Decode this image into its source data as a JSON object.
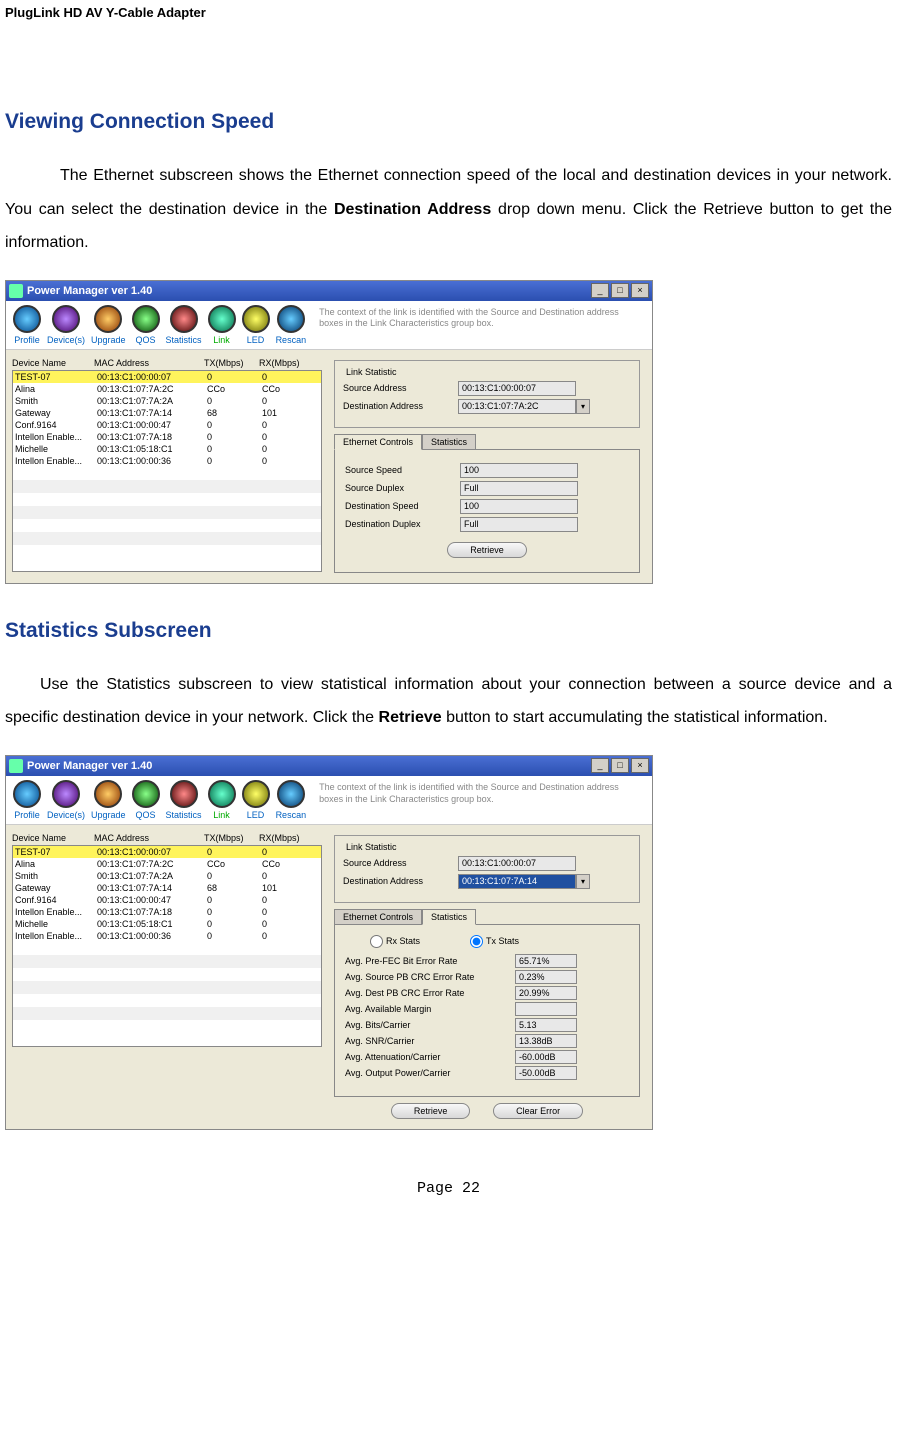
{
  "page_header": "PlugLink HD AV Y-Cable Adapter",
  "section1": {
    "title": "Viewing Connection Speed",
    "para": "The Ethernet subscreen shows the Ethernet connection speed of the local and destination devices in your network. You can select the destination device in the ",
    "bold": "Destination Address",
    "para2": " drop down menu. Click the Retrieve button to get the information."
  },
  "section2": {
    "title": "Statistics Subscreen",
    "para1": "Use the Statistics subscreen to view statistical information about your connection between a source device and a specific destination device in your network. Click the ",
    "bold": "Retrieve",
    "para2": " button to start accumulating the statistical information."
  },
  "app": {
    "title": "Power Manager ver 1.40",
    "context": "The context of the link is identified with the Source and Destination address boxes in the Link Characteristics group box.",
    "toolbar": {
      "profile": "Profile",
      "devices": "Device(s)",
      "upgrade": "Upgrade",
      "qos": "QOS",
      "stats": "Statistics",
      "link": "Link",
      "led": "LED",
      "rescan": "Rescan"
    },
    "headers": {
      "name": "Device Name",
      "mac": "MAC Address",
      "tx": "TX(Mbps)",
      "rx": "RX(Mbps)"
    },
    "rows": [
      {
        "name": "TEST-07",
        "mac": "00:13:C1:00:00:07",
        "tx": "0",
        "rx": "0"
      },
      {
        "name": "Alina",
        "mac": "00:13:C1:07:7A:2C",
        "tx": "CCo",
        "rx": "CCo"
      },
      {
        "name": "Smith",
        "mac": "00:13:C1:07:7A:2A",
        "tx": "0",
        "rx": "0"
      },
      {
        "name": "Gateway",
        "mac": "00:13:C1:07:7A:14",
        "tx": "68",
        "rx": "101"
      },
      {
        "name": "Conf.9164",
        "mac": "00:13:C1:00:00:47",
        "tx": "0",
        "rx": "0"
      },
      {
        "name": "Intellon Enable...",
        "mac": "00:13:C1:07:7A:18",
        "tx": "0",
        "rx": "0"
      },
      {
        "name": "Michelle",
        "mac": "00:13:C1:05:18:C1",
        "tx": "0",
        "rx": "0"
      },
      {
        "name": "Intellon Enable...",
        "mac": "00:13:C1:00:00:36",
        "tx": "0",
        "rx": "0"
      }
    ],
    "link_group": "Link Statistic",
    "src_addr_label": "Source Address",
    "dst_addr_label": "Destination Address",
    "src_addr": "00:13:C1:00:00:07",
    "dst_addr1": "00:13:C1:07:7A:2C",
    "dst_addr2": "00:13:C1:07:7A:14",
    "tab_eth": "Ethernet Controls",
    "tab_stats": "Statistics",
    "eth": {
      "src_speed_l": "Source Speed",
      "src_speed": "100",
      "src_dup_l": "Source Duplex",
      "src_dup": "Full",
      "dst_speed_l": "Destination Speed",
      "dst_speed": "100",
      "dst_dup_l": "Destination Duplex",
      "dst_dup": "Full"
    },
    "retrieve": "Retrieve",
    "clear": "Clear Error",
    "radio_rx": "Rx Stats",
    "radio_tx": "Tx Stats",
    "stats": [
      {
        "l": "Avg. Pre-FEC Bit Error Rate",
        "v": "65.71%"
      },
      {
        "l": "Avg. Source PB CRC Error Rate",
        "v": "0.23%"
      },
      {
        "l": "Avg. Dest PB CRC Error Rate",
        "v": "20.99%"
      },
      {
        "l": "Avg. Available Margin",
        "v": ""
      },
      {
        "l": "Avg. Bits/Carrier",
        "v": "5.13"
      },
      {
        "l": "Avg. SNR/Carrier",
        "v": "13.38dB"
      },
      {
        "l": "Avg. Attenuation/Carrier",
        "v": "-60.00dB"
      },
      {
        "l": "Avg. Output Power/Carrier",
        "v": "-50.00dB"
      }
    ]
  },
  "footer": "Page 22"
}
